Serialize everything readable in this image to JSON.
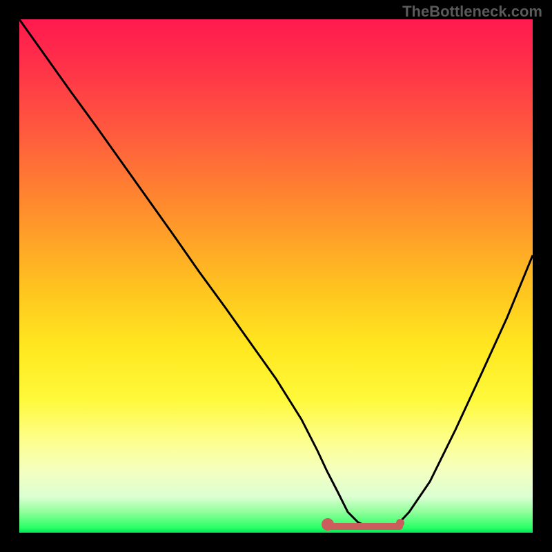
{
  "watermark": "TheBottleneck.com",
  "chart_data": {
    "type": "line",
    "title": "",
    "xlabel": "",
    "ylabel": "",
    "xlim": [
      0,
      100
    ],
    "ylim": [
      0,
      100
    ],
    "series": [
      {
        "name": "bottleneck-curve",
        "x": [
          0,
          5,
          10,
          15,
          20,
          25,
          30,
          35,
          40,
          45,
          50,
          55,
          58,
          60,
          62,
          64,
          66,
          68,
          70,
          72,
          74,
          76,
          80,
          85,
          90,
          95,
          100
        ],
        "y": [
          100,
          93,
          86,
          79,
          72,
          65,
          58,
          51,
          44,
          37,
          30,
          22,
          16,
          12,
          8,
          4,
          2,
          1,
          1,
          1,
          2,
          4,
          10,
          20,
          31,
          42,
          54
        ]
      }
    ],
    "optimal_range": {
      "x_start": 60,
      "x_end": 74,
      "y": 1
    },
    "markers": [
      {
        "x": 60,
        "y": 2,
        "size": "large"
      },
      {
        "x": 74,
        "y": 2,
        "size": "small"
      }
    ],
    "colors": {
      "curve": "#000000",
      "optimal_band": "#cc5d5d",
      "gradient_top": "#ff1a4f",
      "gradient_bottom": "#00e858",
      "background": "#000000",
      "watermark": "#5a5a5a"
    }
  }
}
